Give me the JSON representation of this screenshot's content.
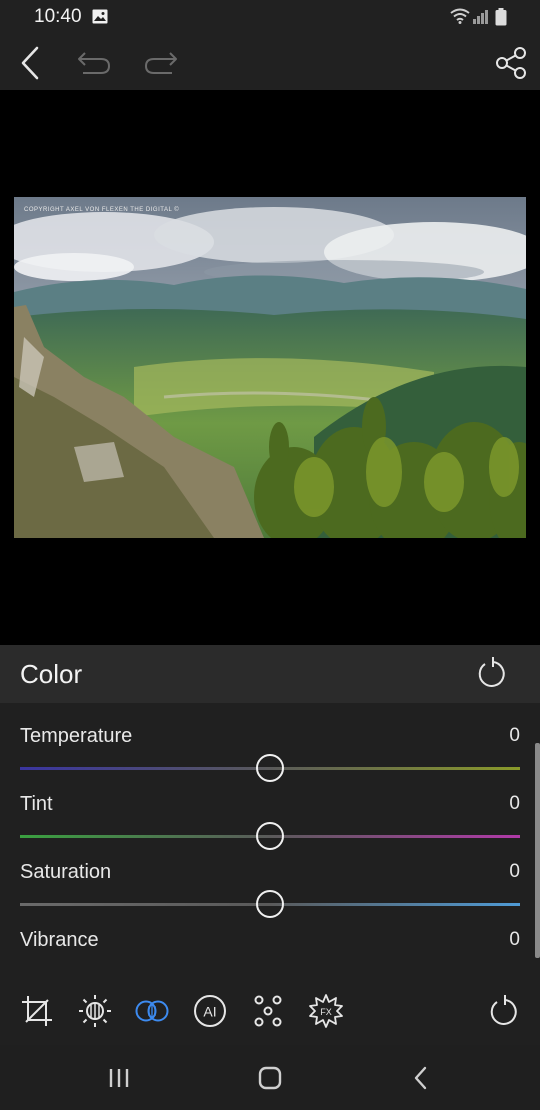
{
  "status_bar": {
    "time": "10:40",
    "icons": [
      "gallery-icon",
      "wifi-icon",
      "signal-icon",
      "battery-icon"
    ]
  },
  "toolbar": {
    "icons": [
      "back-arrow-icon",
      "undo-icon",
      "redo-icon",
      "share-icon"
    ]
  },
  "photo": {
    "watermark": "COPYRIGHT AXEL VON FLEXEN THE DIGITAL ©"
  },
  "panel": {
    "title": "Color",
    "reset_icon": "reset-icon",
    "sliders": [
      {
        "label": "Temperature",
        "value": "0",
        "position": 0.5,
        "colors": [
          "#3a35a0",
          "#8a9a2a"
        ]
      },
      {
        "label": "Tint",
        "value": "0",
        "position": 0.5,
        "colors": [
          "#3aa040",
          "#b03aa8"
        ]
      },
      {
        "label": "Saturation",
        "value": "0",
        "position": 0.5,
        "colors": [
          "#6a6a6a",
          "#4f9bd6"
        ]
      },
      {
        "label": "Vibrance",
        "value": "0"
      }
    ]
  },
  "tools": {
    "items": [
      "crop-icon",
      "light-icon",
      "color-icon",
      "ai-icon",
      "detail-icon",
      "effects-icon",
      "reset-all-icon"
    ],
    "active": "color-icon",
    "accent_color": "#3d8bf0"
  },
  "nav": {
    "icons": [
      "recents-icon",
      "home-icon",
      "back-icon"
    ]
  }
}
